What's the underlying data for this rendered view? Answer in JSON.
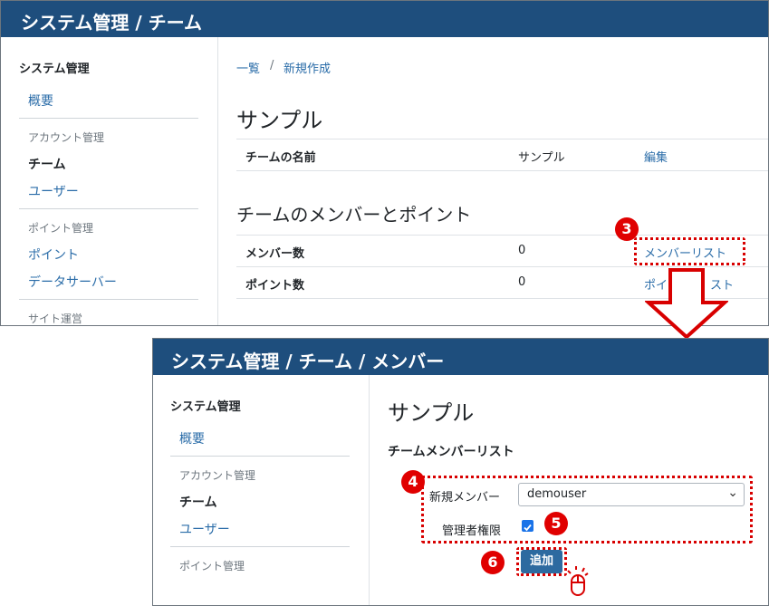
{
  "panel1": {
    "header_title": "システム管理 / チーム",
    "sidebar": {
      "section_title": "システム管理",
      "overview": "概要",
      "account_group": "アカウント管理",
      "team": "チーム",
      "user": "ユーザー",
      "point_group": "ポイント管理",
      "point": "ポイント",
      "data_server": "データサーバー",
      "site_group": "サイト運営"
    },
    "breadcrumb": {
      "list": "一覧",
      "sep": "/",
      "new": "新規作成"
    },
    "title": "サンプル",
    "team_row": {
      "label": "チームの名前",
      "value": "サンプル",
      "action": "編集"
    },
    "members_title": "チームのメンバーとポイント",
    "member_row": {
      "label": "メンバー数",
      "value": "0",
      "action": "メンバーリスト"
    },
    "point_row": {
      "label": "ポイント数",
      "value": "0",
      "action": "ポイ",
      "action_tail": "スト"
    }
  },
  "panel2": {
    "header_title": "システム管理 / チーム / メンバー",
    "sidebar": {
      "section_title": "システム管理",
      "overview": "概要",
      "account_group": "アカウント管理",
      "team": "チーム",
      "user": "ユーザー",
      "point_group": "ポイント管理"
    },
    "title": "サンプル",
    "subtitle": "チームメンバーリスト",
    "form": {
      "new_member_label": "新規メンバー",
      "new_member_value": "demouser",
      "admin_label": "管理者権限",
      "admin_checked": true,
      "add_button": "追加"
    }
  },
  "steps": {
    "step3": "3",
    "step4": "4",
    "step5": "5",
    "step6": "6"
  },
  "colors": {
    "header": "#1e4e7d",
    "link": "#2a6ca8",
    "highlight": "#d80000",
    "button": "#2d6aa0"
  }
}
